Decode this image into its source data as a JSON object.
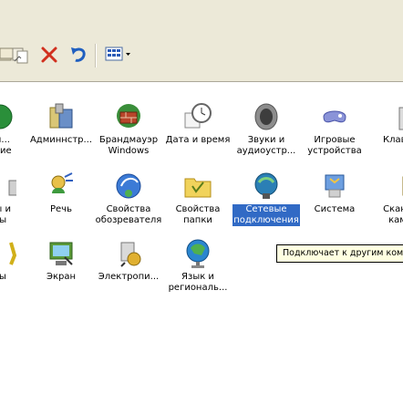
{
  "window": {
    "toolbar": {
      "view_icon": "view-menu-icon"
    }
  },
  "items": [
    {
      "label_line1": "ти...",
      "label_line2": "ение"
    },
    {
      "label_line1": "Админнстр...",
      "label_line2": ""
    },
    {
      "label_line1": "Брандмауэр",
      "label_line2": "Windows"
    },
    {
      "label_line1": "Дата и время",
      "label_line2": ""
    },
    {
      "label_line1": "Звуки и",
      "label_line2": "аудиоустр..."
    },
    {
      "label_line1": "Игровые",
      "label_line2": "устройства"
    },
    {
      "label_line1": "Клави",
      "label_line2": ""
    },
    {
      "label_line1": "ры и",
      "label_line2": "ры"
    },
    {
      "label_line1": "Речь",
      "label_line2": ""
    },
    {
      "label_line1": "Свойства",
      "label_line2": "обозревателя"
    },
    {
      "label_line1": "Свойства",
      "label_line2": "папки"
    },
    {
      "label_line1": "Сетевые",
      "label_line2": "подключения"
    },
    {
      "label_line1": "Система",
      "label_line2": ""
    },
    {
      "label_line1": "Скане",
      "label_line2": "кам"
    },
    {
      "label_line1": "ты",
      "label_line2": ""
    },
    {
      "label_line1": "Экран",
      "label_line2": ""
    },
    {
      "label_line1": "Электропи...",
      "label_line2": ""
    },
    {
      "label_line1": "Язык и",
      "label_line2": "региональ..."
    }
  ],
  "tooltip": "Подключает к другим ком"
}
